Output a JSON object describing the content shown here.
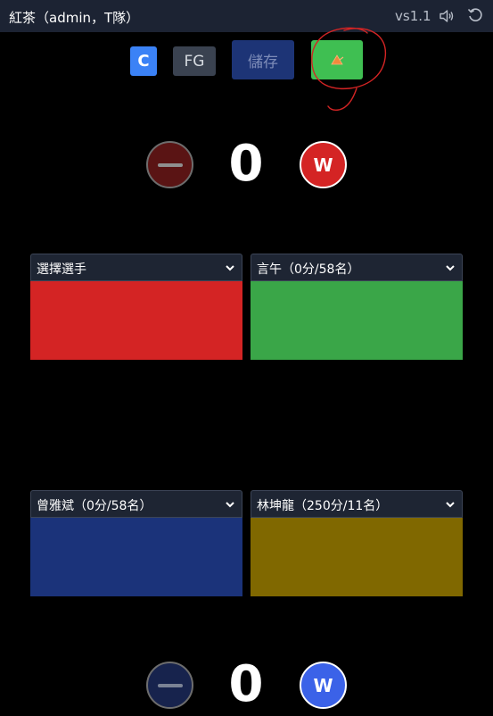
{
  "header": {
    "title": "紅茶（admin，T隊）",
    "version": "vs1.1",
    "icons": [
      "volume-icon",
      "refresh-icon"
    ]
  },
  "toolbar": {
    "c_label": "C",
    "fg_label": "FG",
    "save_label": "儲存",
    "horn_icon": "horn-icon",
    "colors": {
      "c": "#3b82f6",
      "fg": "#3a4250",
      "save": "#1d3476",
      "horn": "#3fbf52"
    }
  },
  "score_top": {
    "value": "0",
    "w_label": "W",
    "w_color": "#d42424"
  },
  "score_bottom": {
    "value": "0",
    "w_label": "W",
    "w_color": "#3b62e8"
  },
  "players": [
    {
      "selected": "選擇選手",
      "color": "#d42424"
    },
    {
      "selected": "言午（0分/58名）",
      "color": "#3aa648"
    },
    {
      "selected": "曾雅斌（0分/58名）",
      "color": "#1b337a"
    },
    {
      "selected": "林坤龍（250分/11名）",
      "color": "#806800"
    }
  ]
}
